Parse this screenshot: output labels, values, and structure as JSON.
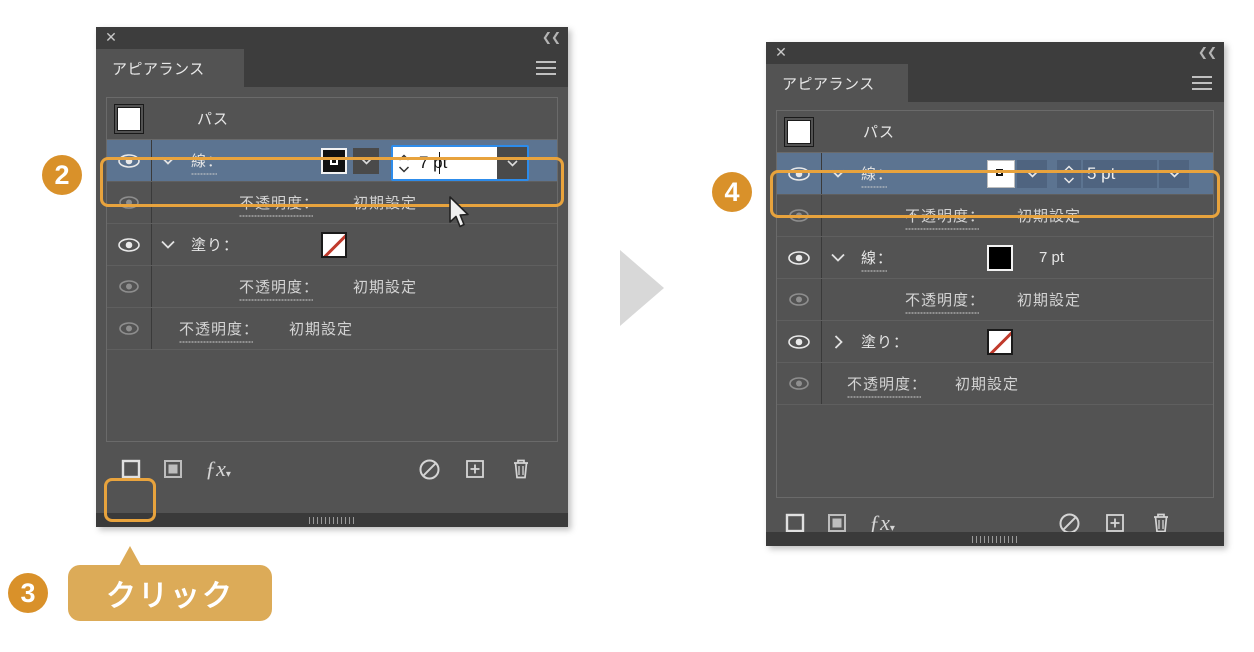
{
  "meta": {
    "accent_orange": "#e8a33d",
    "badge_orange": "#d9912a",
    "callout_bg": "#dcab58",
    "panel_bg": "#535353",
    "panel_header_bg": "#3d3d3d",
    "row_selected_bg": "#5c7491",
    "focus_blue": "#2d8ceb",
    "arrow_gray": "#d8d8d8"
  },
  "left_panel": {
    "close_icon": "close-x-icon",
    "collapse_icon": "double-chevron-left-icon",
    "tab_label": "アピアランス",
    "menu_icon": "hamburger-menu-icon",
    "object_row": {
      "label": "パス",
      "swatch": "white-path-swatch"
    },
    "rows": [
      {
        "name": "stroke-row",
        "label": "線：",
        "selected": true,
        "eye": "visible",
        "disclosure": "chevron-down-icon",
        "swatch": "black-ring-swatch",
        "swatch_dropdown": "chevron-down-icon",
        "value": "7 pt",
        "value_editing": true,
        "stepper": "up-down-stepper-icon",
        "width_dropdown": "chevron-down-icon"
      },
      {
        "name": "stroke-opacity-row",
        "label": "不透明度：",
        "value": "初期設定",
        "eye": "dim",
        "indent": 2
      },
      {
        "name": "fill-row",
        "label": "塗り：",
        "eye": "visible",
        "disclosure": "chevron-down-icon",
        "swatch": "none-red-slash-swatch",
        "indent": 1
      },
      {
        "name": "fill-opacity-row",
        "label": "不透明度：",
        "value": "初期設定",
        "eye": "dim",
        "indent": 2
      },
      {
        "name": "object-opacity-row",
        "label": "不透明度：",
        "value": "初期設定",
        "eye": "dim",
        "indent": 1
      }
    ],
    "footer_buttons": [
      {
        "name": "add-new-stroke-button",
        "icon": "outline-square-icon",
        "highlighted": true
      },
      {
        "name": "add-new-fill-button",
        "icon": "filled-square-icon"
      },
      {
        "name": "add-effect-button",
        "icon": "fx-icon"
      },
      {
        "name": "clear-appearance-button",
        "icon": "no-entry-icon"
      },
      {
        "name": "duplicate-item-button",
        "icon": "plus-square-icon"
      },
      {
        "name": "delete-item-button",
        "icon": "trash-icon"
      }
    ]
  },
  "right_panel": {
    "close_icon": "close-x-icon",
    "collapse_icon": "double-chevron-left-icon",
    "tab_label": "アピアランス",
    "menu_icon": "hamburger-menu-icon",
    "object_row": {
      "label": "パス",
      "swatch": "white-path-swatch"
    },
    "rows": [
      {
        "name": "stroke-row-new",
        "label": "線：",
        "selected": true,
        "eye": "visible",
        "disclosure": "chevron-down-icon",
        "swatch": "white-mini-square-swatch",
        "swatch_dropdown": "chevron-down-icon",
        "value": "5 pt",
        "value_editing": false,
        "stepper": "up-down-stepper-icon",
        "width_dropdown": "chevron-down-icon"
      },
      {
        "name": "stroke-opacity-row-new",
        "label": "不透明度：",
        "value": "初期設定",
        "eye": "dim",
        "indent": 2
      },
      {
        "name": "stroke-row-old",
        "label": "線：",
        "eye": "visible",
        "disclosure": "chevron-down-icon",
        "swatch": "solid-black-swatch",
        "value": "7 pt",
        "indent": 1
      },
      {
        "name": "stroke-opacity-row-old",
        "label": "不透明度：",
        "value": "初期設定",
        "eye": "dim",
        "indent": 2
      },
      {
        "name": "fill-row",
        "label": "塗り：",
        "eye": "visible",
        "disclosure": "chevron-right-icon",
        "swatch": "none-red-slash-swatch",
        "indent": 1
      },
      {
        "name": "object-opacity-row",
        "label": "不透明度：",
        "value": "初期設定",
        "eye": "dim",
        "indent": 1
      }
    ],
    "footer_buttons": [
      {
        "name": "add-new-stroke-button",
        "icon": "outline-square-icon"
      },
      {
        "name": "add-new-fill-button",
        "icon": "filled-square-icon"
      },
      {
        "name": "add-effect-button",
        "icon": "fx-icon"
      },
      {
        "name": "clear-appearance-button",
        "icon": "no-entry-icon"
      },
      {
        "name": "duplicate-item-button",
        "icon": "plus-square-icon"
      },
      {
        "name": "delete-item-button",
        "icon": "trash-icon"
      }
    ]
  },
  "annotations": {
    "badge_2": "2",
    "badge_3": "3",
    "badge_4": "4",
    "callout_click": "クリック",
    "flow_arrow": "right-triangle-arrow"
  }
}
